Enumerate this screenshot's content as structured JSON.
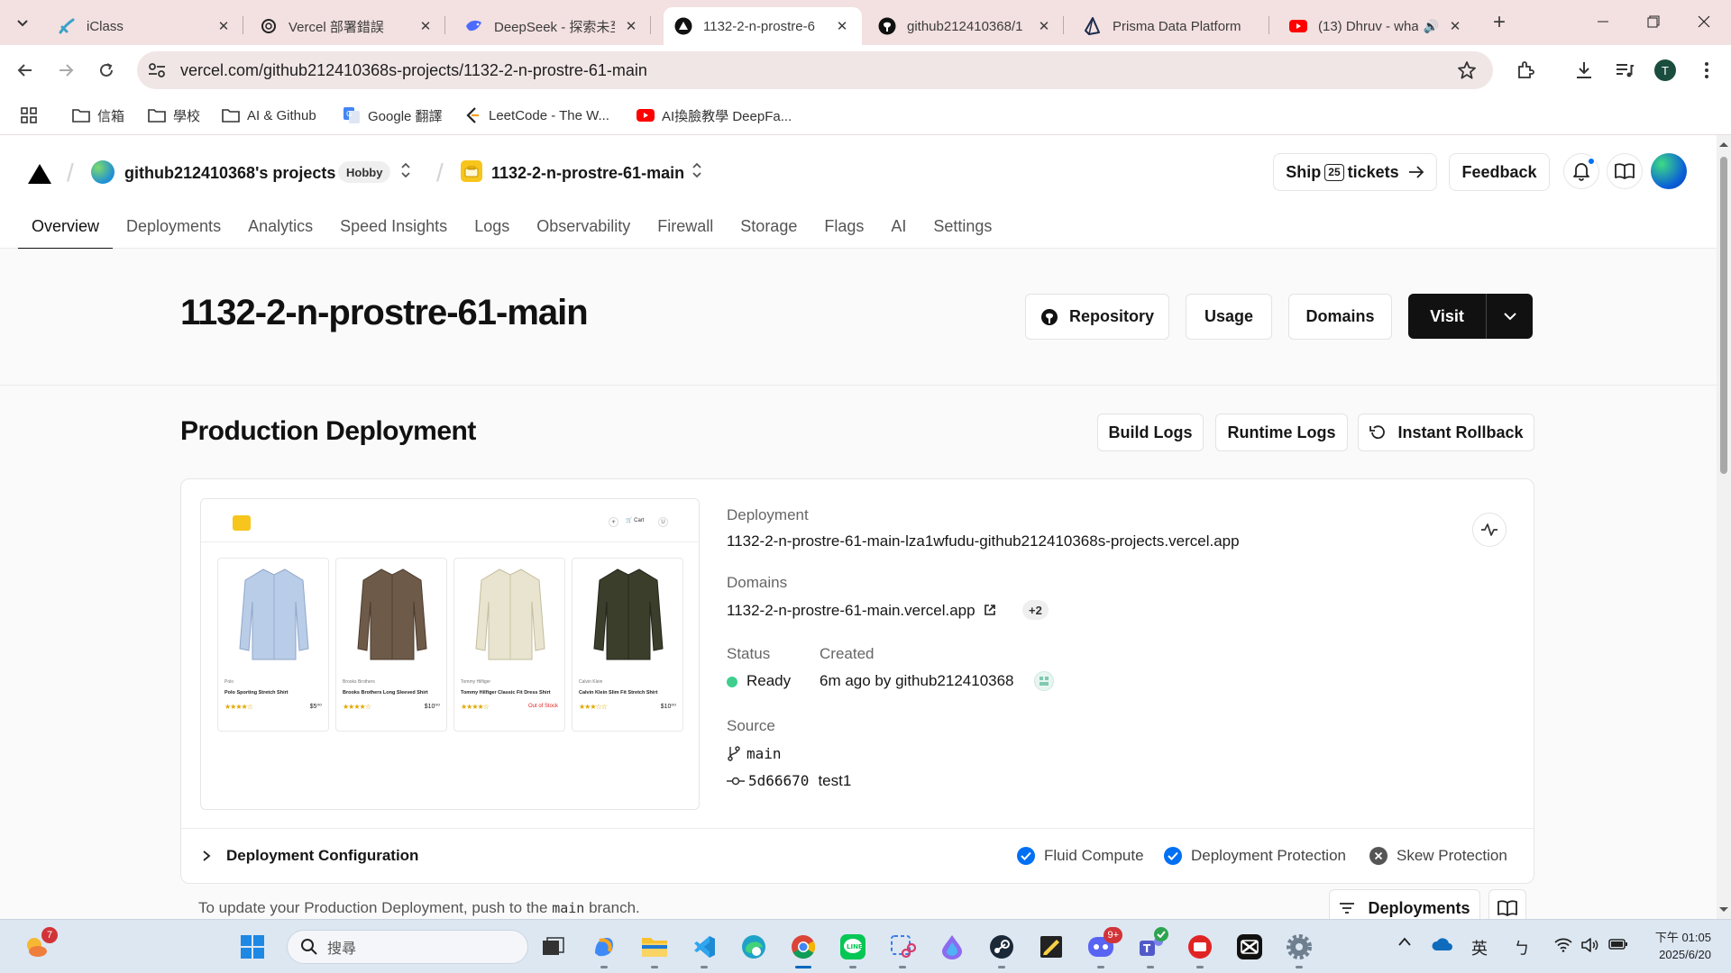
{
  "browser": {
    "tabs": [
      {
        "title": "iClass",
        "icon": "iclass-icon"
      },
      {
        "title": "Vercel 部署錯誤",
        "icon": "openai-icon"
      },
      {
        "title": "DeepSeek - 探索未至",
        "icon": "deepseek-icon"
      },
      {
        "title": "1132-2-n-prostre-6",
        "icon": "vercel-icon",
        "active": true
      },
      {
        "title": "github212410368/1",
        "icon": "github-icon"
      },
      {
        "title": "Prisma Data Platform",
        "icon": "prisma-icon"
      },
      {
        "title": "(13) Dhruv - wha",
        "icon": "youtube-icon",
        "audio": true
      }
    ],
    "url": "vercel.com/github212410368s-projects/1132-2-n-prostre-61-main",
    "profile_initial": "T",
    "bookmarks": [
      {
        "label": "信箱",
        "icon": "folder-icon"
      },
      {
        "label": "學校",
        "icon": "folder-icon"
      },
      {
        "label": "AI & Github",
        "icon": "folder-icon"
      },
      {
        "label": "Google 翻譯",
        "icon": "google-translate-icon"
      },
      {
        "label": "LeetCode - The W...",
        "icon": "leetcode-icon"
      },
      {
        "label": "AI換臉教學 DeepFa...",
        "icon": "youtube-icon"
      }
    ]
  },
  "header": {
    "team_name": "github212410368's projects",
    "plan_badge": "Hobby",
    "project_name": "1132-2-n-prostre-61-main",
    "ship_label_pre": "Ship",
    "ship_count": "25",
    "ship_label_post": "tickets",
    "feedback_label": "Feedback"
  },
  "nav": {
    "items": [
      "Overview",
      "Deployments",
      "Analytics",
      "Speed Insights",
      "Logs",
      "Observability",
      "Firewall",
      "Storage",
      "Flags",
      "AI",
      "Settings"
    ],
    "active": "Overview"
  },
  "project": {
    "title": "1132-2-n-prostre-61-main",
    "repository_label": "Repository",
    "usage_label": "Usage",
    "domains_label": "Domains",
    "visit_label": "Visit"
  },
  "production": {
    "section_title": "Production Deployment",
    "build_logs_label": "Build Logs",
    "runtime_logs_label": "Runtime Logs",
    "rollback_label": "Instant Rollback",
    "deployment_label": "Deployment",
    "deployment_url": "1132-2-n-prostre-61-main-lza1wfudu-github212410368s-projects.vercel.app",
    "domains_label": "Domains",
    "domain": "1132-2-n-prostre-61-main.vercel.app",
    "domains_more": "+2",
    "status_label": "Status",
    "status_value": "Ready",
    "created_label": "Created",
    "created_value": "6m ago by github212410368",
    "source_label": "Source",
    "branch": "main",
    "commit_hash": "5d66670",
    "commit_message": "test1",
    "config_label": "Deployment Configuration",
    "features": [
      {
        "label": "Fluid Compute",
        "enabled": true
      },
      {
        "label": "Deployment Protection",
        "enabled": true
      },
      {
        "label": "Skew Protection",
        "enabled": false
      }
    ],
    "footer_pre": "To update your Production Deployment, push to the",
    "footer_code": "main",
    "footer_post": "branch.",
    "deployments_button": "Deployments"
  },
  "preview": {
    "cart_label": "🛒 Cart",
    "avatar_letter": "U",
    "products": [
      {
        "brand": "Polo",
        "name": "Polo Sporting Stretch Shirt",
        "stars": "★★★★☆",
        "price": "$5⁰⁰",
        "color": "#b9cde8"
      },
      {
        "brand": "Brooks Brothers",
        "name": "Brooks Brothers Long Sleeved Shirt",
        "stars": "★★★★☆",
        "price": "$10⁰⁰",
        "color": "#6e5a48"
      },
      {
        "brand": "Tommy Hilfiger",
        "name": "Tommy Hilfiger Classic Fit Dress Shirt",
        "stars": "★★★★☆",
        "price": "Out of Stock",
        "color": "#e9e4cf"
      },
      {
        "brand": "Calvin Klein",
        "name": "Calvin Klein Slim Fit Stretch Shirt",
        "stars": "★★★☆☆",
        "price": "$10⁰⁰",
        "color": "#3a3e2a"
      }
    ]
  },
  "taskbar": {
    "search_placeholder": "搜尋",
    "weather_badge": "7",
    "discord_badge": "9+",
    "ime_label": "英",
    "ime_mode": "ㄅ",
    "time": "下午 01:05",
    "date": "2025/6/20"
  },
  "colors": {
    "accent": "#0070f3",
    "ready": "#3ecf8e",
    "chrome_frame": "#f3e0e0",
    "project_icon": "#f7c51b"
  }
}
